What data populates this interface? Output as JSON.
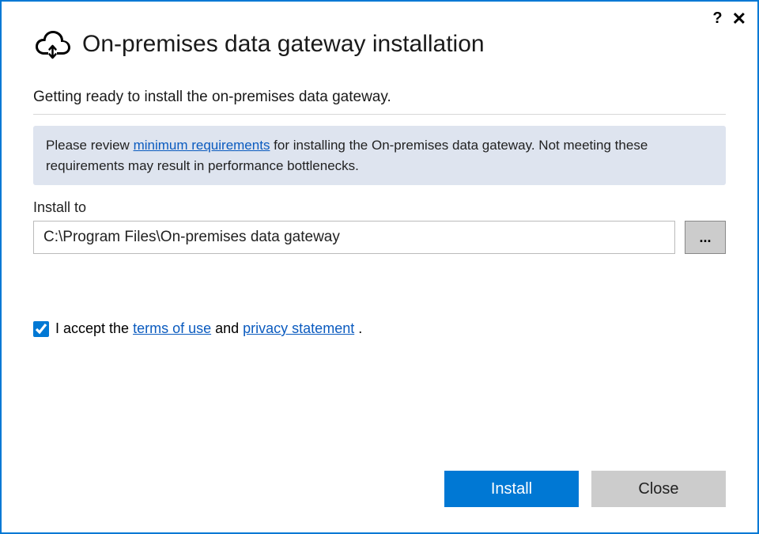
{
  "titlebar": {
    "help": "?",
    "close": "✕"
  },
  "header": {
    "title": "On-premises data gateway installation"
  },
  "subtitle": "Getting ready to install the on-premises data gateway.",
  "banner": {
    "text_before": "Please review ",
    "link": "minimum requirements",
    "text_after": " for installing the On-premises data gateway. Not meeting these requirements may result in performance bottlenecks."
  },
  "install": {
    "label": "Install to",
    "path": "C:\\Program Files\\On-premises data gateway",
    "browse": "..."
  },
  "accept": {
    "checked": true,
    "text_before": "I accept the ",
    "terms_link": "terms of use",
    "and": " and ",
    "privacy_link": "privacy statement",
    "period": " ."
  },
  "buttons": {
    "install": "Install",
    "close": "Close"
  }
}
